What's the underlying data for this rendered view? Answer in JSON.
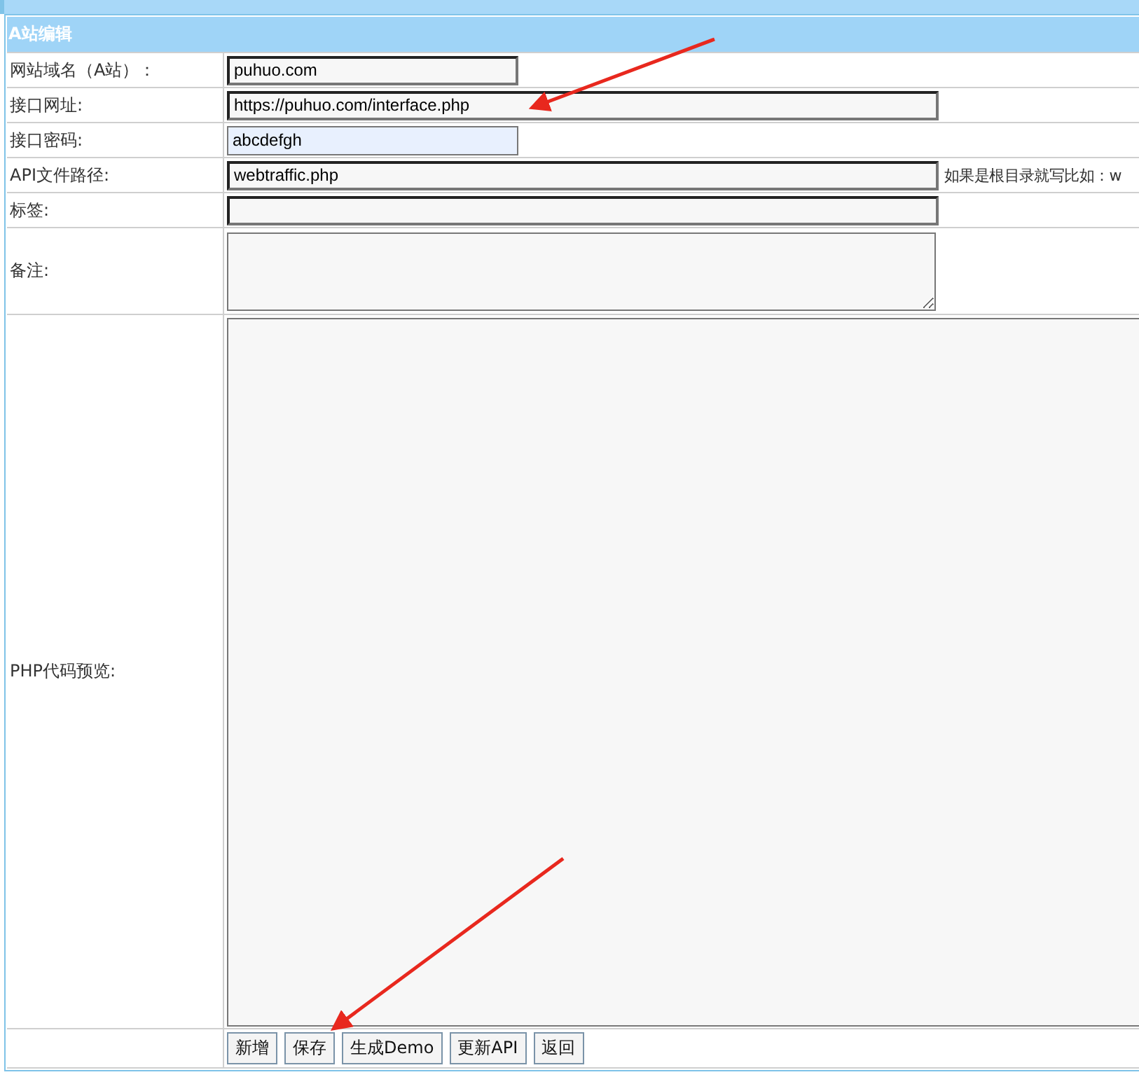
{
  "panel": {
    "title": "A站编辑"
  },
  "rows": [
    {
      "kind": "shorttext",
      "label": "网站域名（A站）：",
      "value": "puhuo.com",
      "autofilled": false
    },
    {
      "kind": "text",
      "label": "接口网址:",
      "value": "https://puhuo.com/interface.php",
      "autofilled": false
    },
    {
      "kind": "shorttext",
      "label": "接口密码:",
      "value": "abcdefgh",
      "autofilled": true
    },
    {
      "kind": "text",
      "label": "API文件路径:",
      "value": "webtraffic.php",
      "autofilled": false,
      "hint": "如果是根目录就写比如：w"
    },
    {
      "kind": "text",
      "label": "标签:",
      "autofilled": false
    },
    {
      "kind": "textarea",
      "label": "备注:"
    },
    {
      "kind": "code",
      "label": "PHP代码预览:"
    },
    {
      "kind": "buttons",
      "buttons": [
        "新增",
        "保存",
        "生成Demo",
        "更新API",
        "返回"
      ]
    }
  ]
}
